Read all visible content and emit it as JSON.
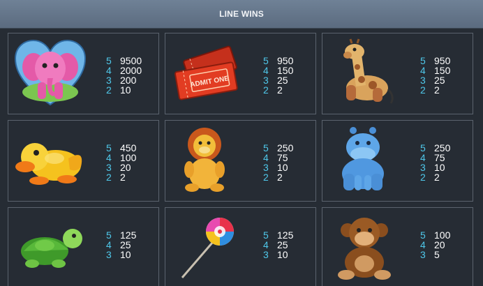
{
  "header": {
    "title": "LINE WINS"
  },
  "symbols": [
    {
      "name": "pink-elephant",
      "pays": [
        {
          "count": "5",
          "value": "9500"
        },
        {
          "count": "4",
          "value": "2000"
        },
        {
          "count": "3",
          "value": "200"
        },
        {
          "count": "2",
          "value": "10"
        }
      ]
    },
    {
      "name": "admit-one-tickets",
      "ticket_text": "ADMIT ONE",
      "pays": [
        {
          "count": "5",
          "value": "950"
        },
        {
          "count": "4",
          "value": "150"
        },
        {
          "count": "3",
          "value": "25"
        },
        {
          "count": "2",
          "value": "2"
        }
      ]
    },
    {
      "name": "giraffe",
      "pays": [
        {
          "count": "5",
          "value": "950"
        },
        {
          "count": "4",
          "value": "150"
        },
        {
          "count": "3",
          "value": "25"
        },
        {
          "count": "2",
          "value": "2"
        }
      ]
    },
    {
      "name": "duck",
      "pays": [
        {
          "count": "5",
          "value": "450"
        },
        {
          "count": "4",
          "value": "100"
        },
        {
          "count": "3",
          "value": "20"
        },
        {
          "count": "2",
          "value": "2"
        }
      ]
    },
    {
      "name": "lion",
      "pays": [
        {
          "count": "5",
          "value": "250"
        },
        {
          "count": "4",
          "value": "75"
        },
        {
          "count": "3",
          "value": "10"
        },
        {
          "count": "2",
          "value": "2"
        }
      ]
    },
    {
      "name": "hippo",
      "pays": [
        {
          "count": "5",
          "value": "250"
        },
        {
          "count": "4",
          "value": "75"
        },
        {
          "count": "3",
          "value": "10"
        },
        {
          "count": "2",
          "value": "2"
        }
      ]
    },
    {
      "name": "turtle",
      "pays": [
        {
          "count": "5",
          "value": "125"
        },
        {
          "count": "4",
          "value": "25"
        },
        {
          "count": "3",
          "value": "10"
        }
      ]
    },
    {
      "name": "lollipop",
      "pays": [
        {
          "count": "5",
          "value": "125"
        },
        {
          "count": "4",
          "value": "25"
        },
        {
          "count": "3",
          "value": "10"
        }
      ]
    },
    {
      "name": "monkey",
      "pays": [
        {
          "count": "5",
          "value": "100"
        },
        {
          "count": "4",
          "value": "20"
        },
        {
          "count": "3",
          "value": "5"
        }
      ]
    }
  ],
  "colors": {
    "count": "#4fc8ea",
    "value": "#ffffff",
    "background": "#262c34",
    "card_border": "#5b636e",
    "header": "#6f8196"
  }
}
